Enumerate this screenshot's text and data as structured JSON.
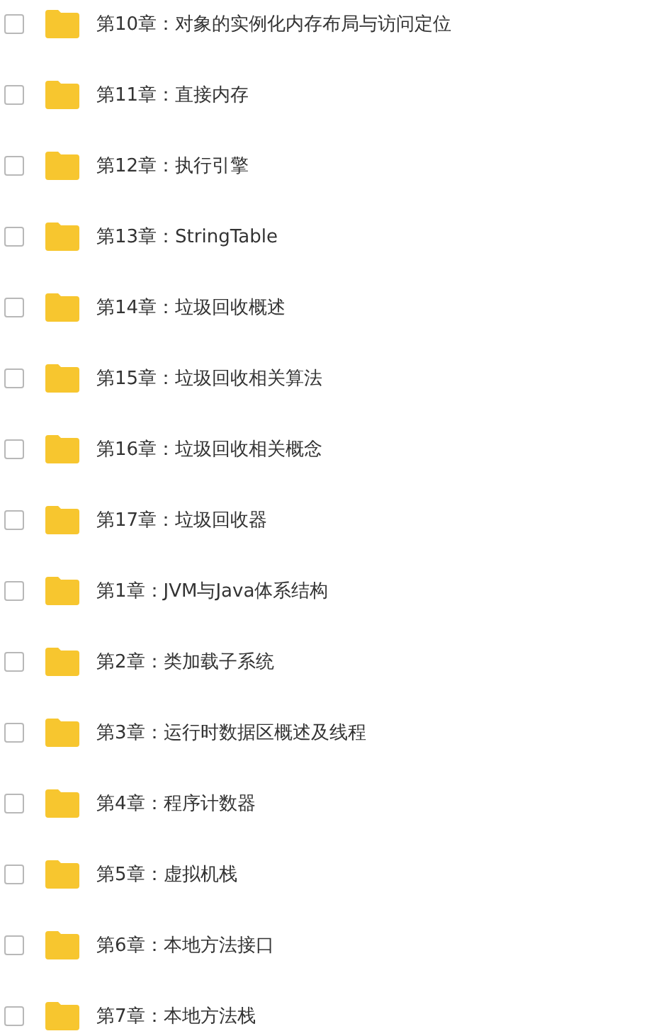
{
  "folders": [
    {
      "name": "第10章：对象的实例化内存布局与访问定位",
      "checked": false
    },
    {
      "name": "第11章：直接内存",
      "checked": false
    },
    {
      "name": "第12章：执行引擎",
      "checked": false
    },
    {
      "name": "第13章：StringTable",
      "checked": false
    },
    {
      "name": "第14章：垃圾回收概述",
      "checked": false
    },
    {
      "name": "第15章：垃圾回收相关算法",
      "checked": false
    },
    {
      "name": "第16章：垃圾回收相关概念",
      "checked": false
    },
    {
      "name": "第17章：垃圾回收器",
      "checked": false
    },
    {
      "name": "第1章：JVM与Java体系结构",
      "checked": false
    },
    {
      "name": "第2章：类加载子系统",
      "checked": false
    },
    {
      "name": "第3章：运行时数据区概述及线程",
      "checked": false
    },
    {
      "name": "第4章：程序计数器",
      "checked": false
    },
    {
      "name": "第5章：虚拟机栈",
      "checked": false
    },
    {
      "name": "第6章：本地方法接口",
      "checked": false
    },
    {
      "name": "第7章：本地方法栈",
      "checked": false
    }
  ]
}
